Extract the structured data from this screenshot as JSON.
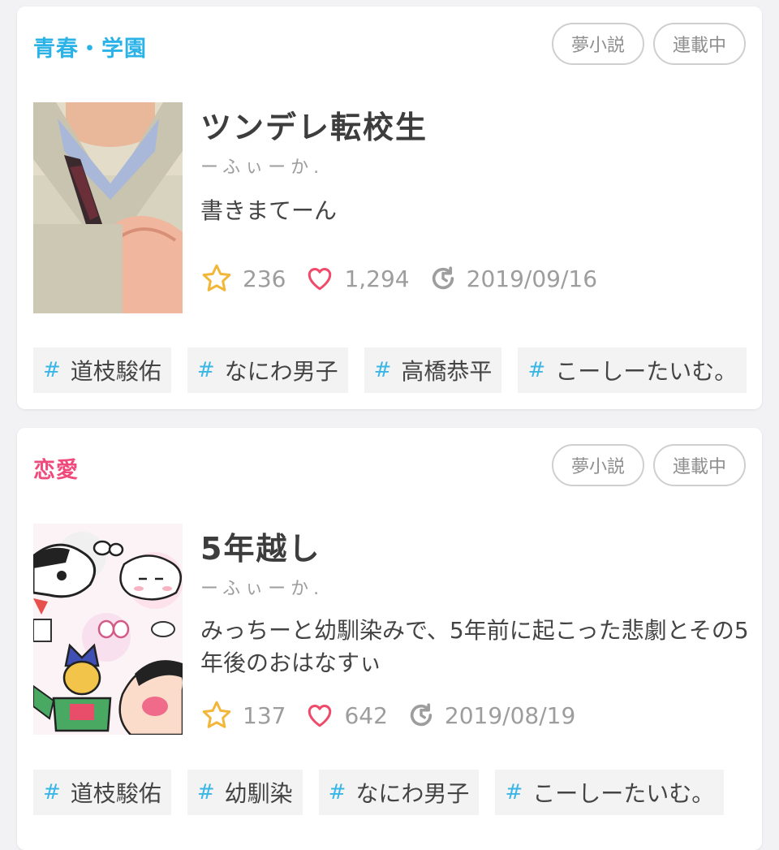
{
  "colors": {
    "genre_school": "#2bb3e8",
    "genre_romance": "#ef4a7c",
    "star": "#f2b63a",
    "heart": "#ef4a6a",
    "tag_hash": "#3ab6e6"
  },
  "stories": [
    {
      "genre": "青春・学園",
      "badges": [
        "夢小説",
        "連載中"
      ],
      "title": "ツンデレ転校生",
      "author": "ーふぃーか.",
      "description": "書きまてーん",
      "stars": "236",
      "likes": "1,294",
      "updated": "2019/09/16",
      "tags": [
        "道枝駿佑",
        "なにわ男子",
        "高橋恭平",
        "こーしーたいむ。"
      ],
      "icons": [
        "star-icon",
        "heart-icon",
        "clock-refresh-icon"
      ]
    },
    {
      "genre": "恋愛",
      "badges": [
        "夢小説",
        "連載中"
      ],
      "title": "5年越し",
      "author": "ーふぃーか.",
      "description": "みっちーと幼馴染みで、5年前に起こった悲劇とその5年後のおはなすぃ",
      "stars": "137",
      "likes": "642",
      "updated": "2019/08/19",
      "tags": [
        "道枝駿佑",
        "幼馴染",
        "なにわ男子",
        "こーしーたいむ。"
      ],
      "icons": [
        "star-icon",
        "heart-icon",
        "clock-refresh-icon"
      ]
    }
  ]
}
